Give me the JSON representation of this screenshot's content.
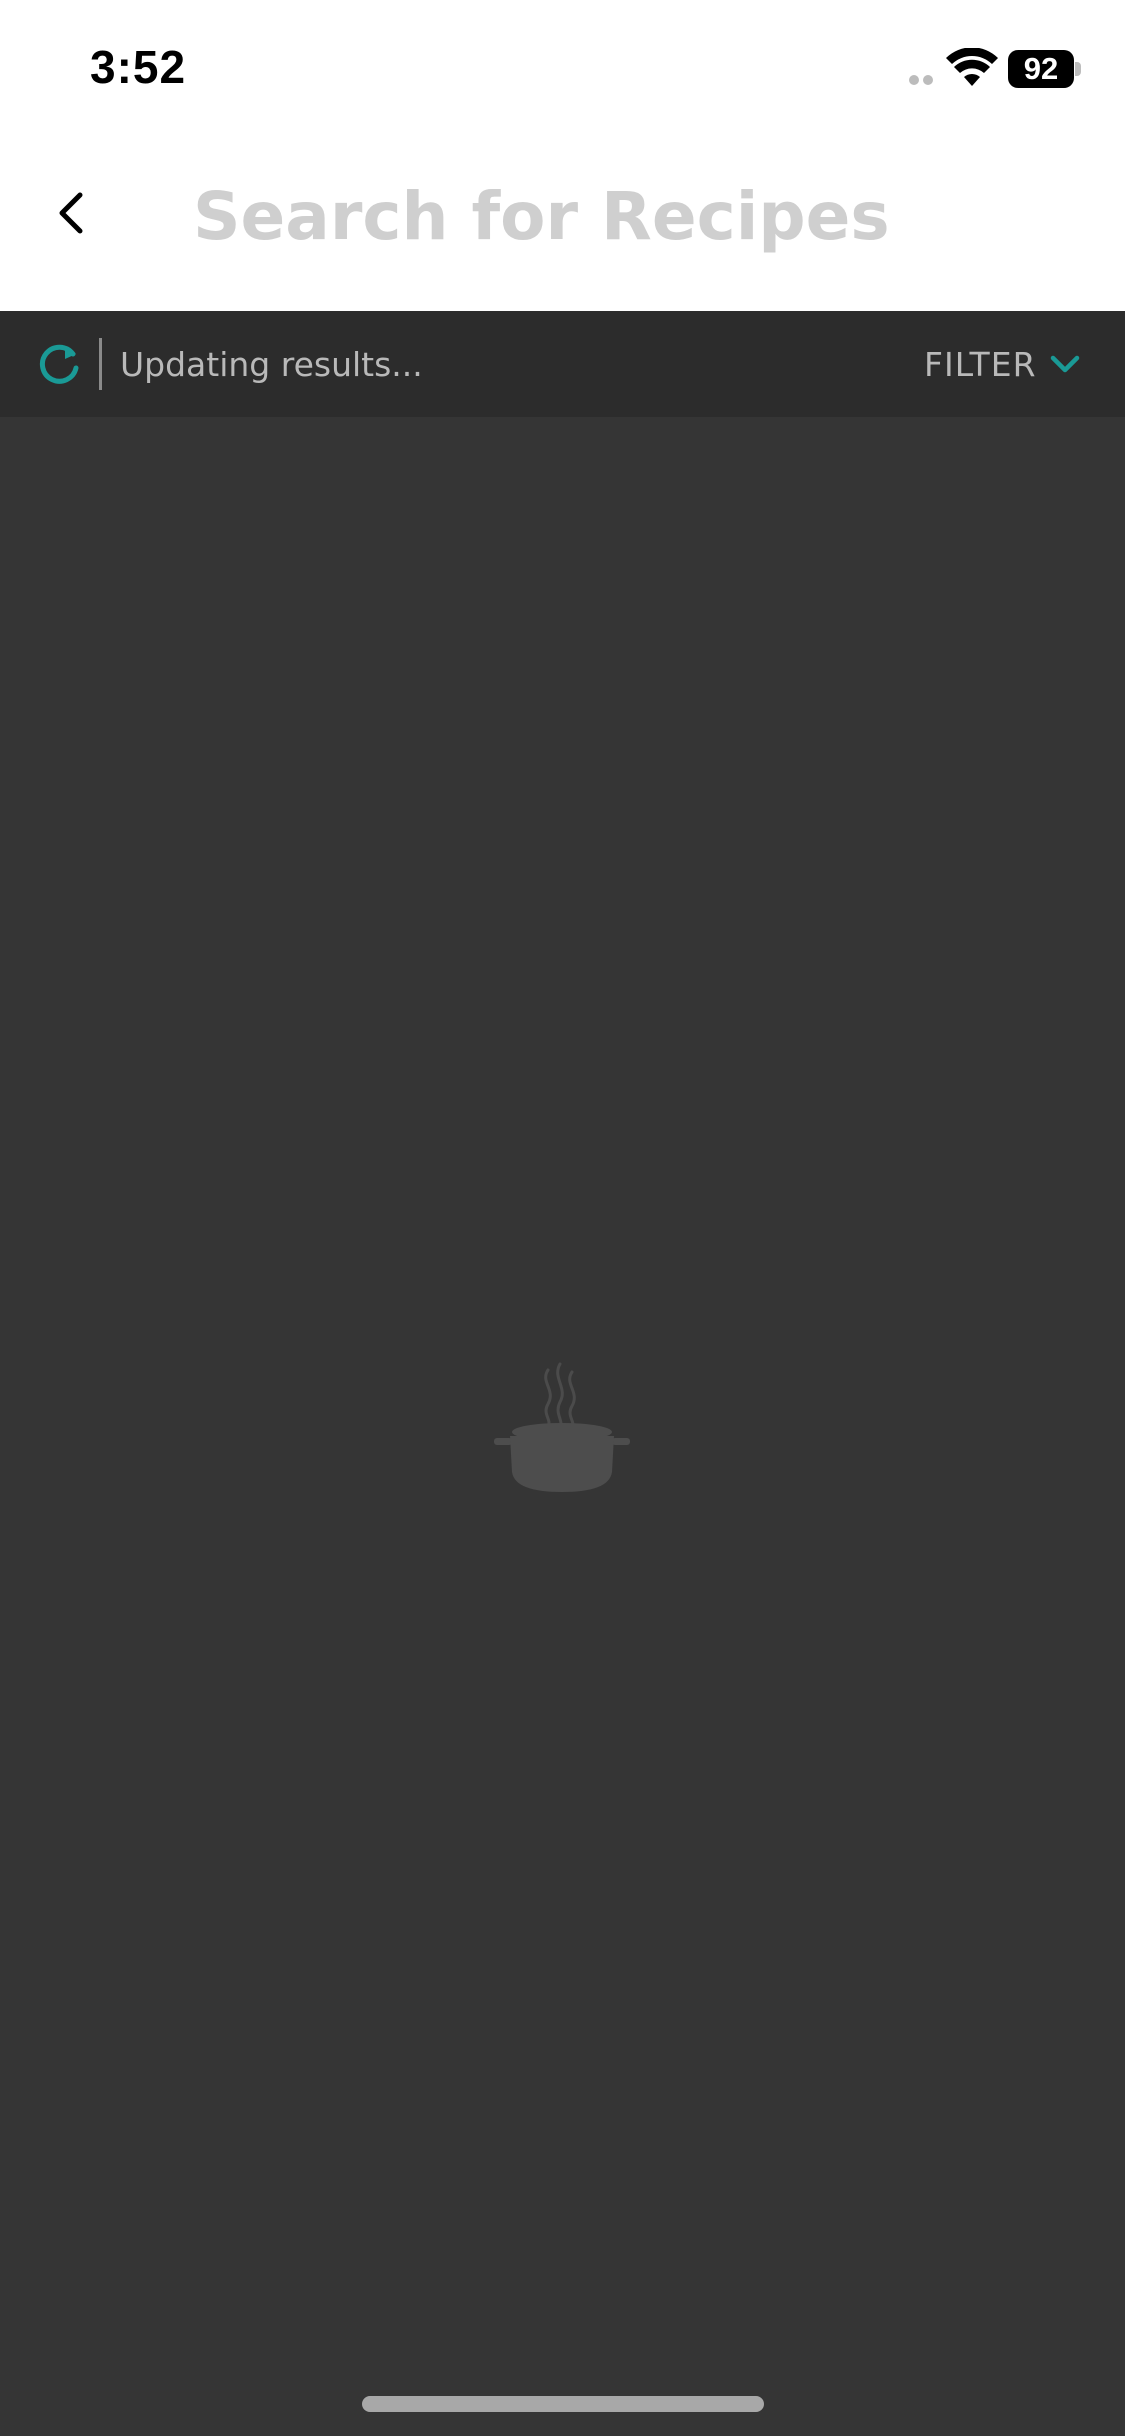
{
  "status_bar": {
    "time": "3:52",
    "battery": "92"
  },
  "header": {
    "search_placeholder": "Search for Recipes",
    "back_icon": "chevron-left-icon"
  },
  "filter_bar": {
    "status_text": "Updating results...",
    "filter_label": "FILTER",
    "refresh_icon": "refresh-icon",
    "chevron_icon": "chevron-down-icon",
    "accent_color": "#1a9a96"
  },
  "content": {
    "loading_icon": "cooking-pot-icon",
    "background_color": "#353535"
  }
}
